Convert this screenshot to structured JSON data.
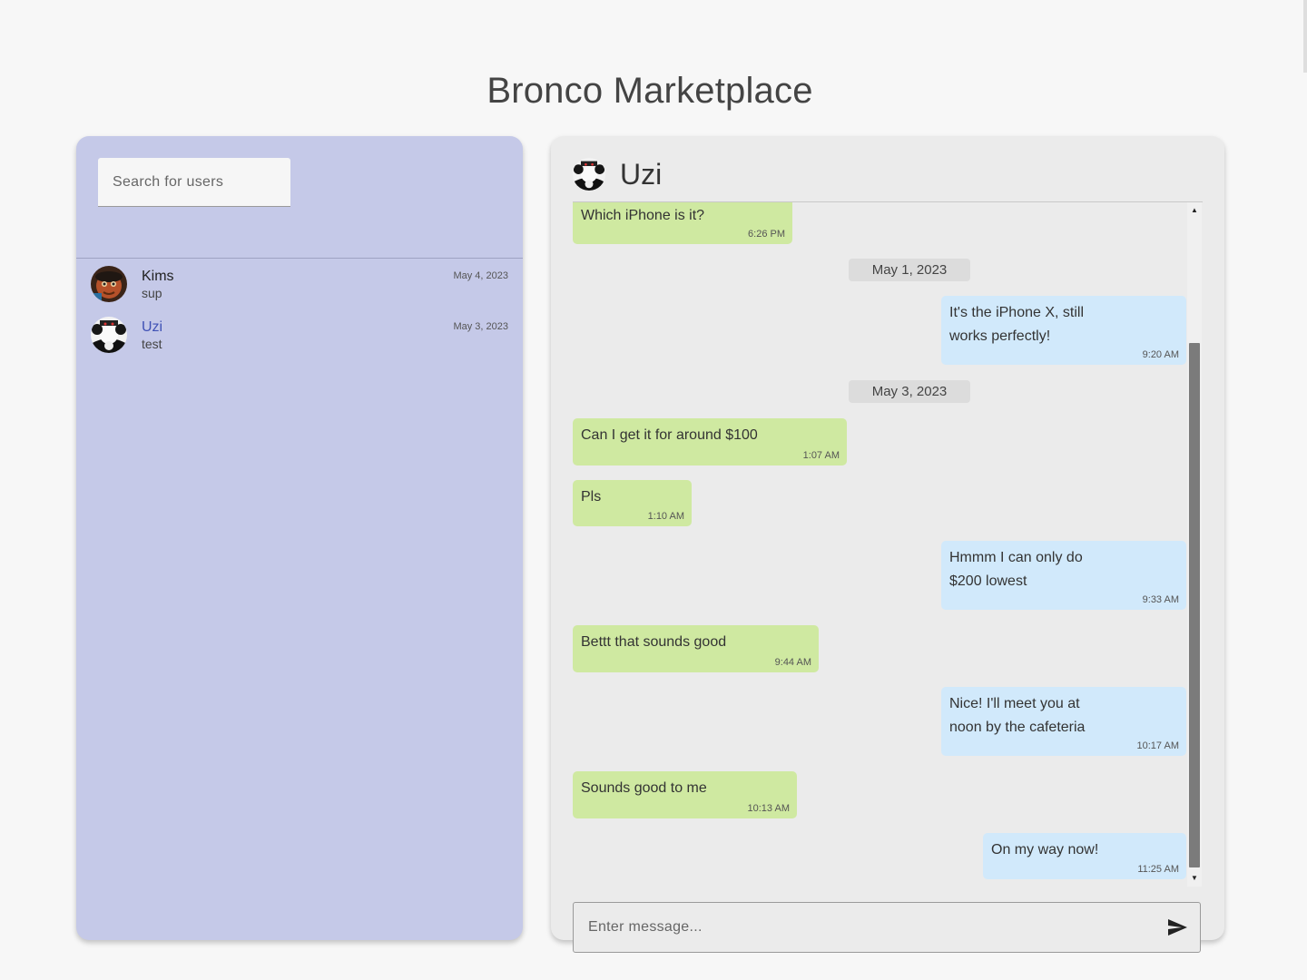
{
  "app": {
    "title": "Bronco Marketplace"
  },
  "sidebar": {
    "search_placeholder": "Search for users",
    "contacts": [
      {
        "name": "Kims",
        "preview": "sup",
        "date": "May 4, 2023",
        "active": false,
        "avatar": "avatar-kims"
      },
      {
        "name": "Uzi",
        "preview": "test",
        "date": "May 3, 2023",
        "active": true,
        "avatar": "avatar-uzi"
      }
    ]
  },
  "chat": {
    "contact_name": "Uzi",
    "messages": [
      {
        "dir": "in",
        "text": "Which iPhone is it?",
        "time": "6:26 PM"
      },
      {
        "type": "date",
        "text": "May 1, 2023"
      },
      {
        "dir": "out",
        "text": "It's the iPhone X, still works perfectly!",
        "time": "9:20 AM"
      },
      {
        "type": "date",
        "text": "May 3, 2023"
      },
      {
        "dir": "in",
        "text": "Can I get it for around $100",
        "time": "1:07 AM"
      },
      {
        "dir": "in",
        "text": "Pls",
        "time": "1:10 AM"
      },
      {
        "dir": "out",
        "text": "Hmmm I can only do $200 lowest",
        "time": "9:33 AM"
      },
      {
        "dir": "in",
        "text": "Bettt that sounds good",
        "time": "9:44 AM"
      },
      {
        "dir": "out",
        "text": "Nice! I'll meet you at noon by the cafeteria",
        "time": "10:17 AM"
      },
      {
        "dir": "in",
        "text": "Sounds good to me",
        "time": "10:13 AM"
      },
      {
        "dir": "out",
        "text": "On my way now!",
        "time": "11:25 AM"
      }
    ],
    "composer_placeholder": "Enter message..."
  },
  "icons": {
    "send": "send-icon",
    "scroll_up": "scroll-up-icon",
    "scroll_down": "scroll-down-icon"
  },
  "colors": {
    "sidebar_bg": "#c5c9e8",
    "incoming_bubble": "#cfe9a1",
    "outgoing_bubble": "#d1e9fb",
    "active_contact": "#3f51b5",
    "panel_bg": "#ebebeb"
  }
}
